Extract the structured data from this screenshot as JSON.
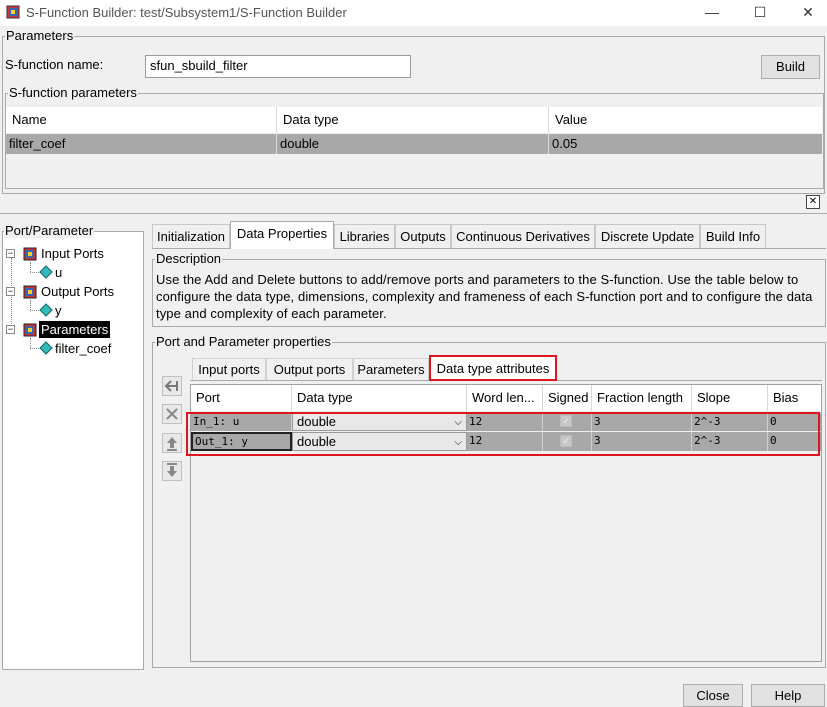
{
  "window": {
    "title": "S-Function Builder: test/Subsystem1/S-Function Builder",
    "minimize": "—",
    "maximize": "☐",
    "close": "✕"
  },
  "parameters_group": {
    "legend": "Parameters",
    "sfunction_name_label": "S-function name:",
    "sfunction_name_value": "sfun_sbuild_filter",
    "build_label": "Build"
  },
  "sfunction_parameters": {
    "legend": "S-function parameters",
    "columns": [
      "Name",
      "Data type",
      "Value"
    ],
    "rows": [
      {
        "name": "filter_coef",
        "data_type": "double",
        "value": "0.05"
      }
    ],
    "close_icon": "✕"
  },
  "port_tree": {
    "legend": "Port/Parameter",
    "items": [
      {
        "label": "Input Ports",
        "icon": "block-icon",
        "children": [
          {
            "label": "u",
            "icon": "port-diamond-icon"
          }
        ]
      },
      {
        "label": "Output Ports",
        "icon": "block-icon",
        "children": [
          {
            "label": "y",
            "icon": "port-diamond-icon"
          }
        ]
      },
      {
        "label": "Parameters",
        "icon": "block-icon",
        "selected": true,
        "children": [
          {
            "label": "filter_coef",
            "icon": "port-diamond-icon"
          }
        ]
      }
    ]
  },
  "tabs": [
    "Initialization",
    "Data Properties",
    "Libraries",
    "Outputs",
    "Continuous Derivatives",
    "Discrete Update",
    "Build Info"
  ],
  "active_tab": "Data Properties",
  "description": {
    "legend": "Description",
    "text": "Use the Add and Delete buttons to add/remove ports and parameters to the S-function. Use the table below to configure the data type, dimensions, complexity and frameness of each S-function port and to configure the data type and complexity of each parameter."
  },
  "port_props": {
    "legend": "Port and Parameter properties",
    "subtabs": [
      "Input ports",
      "Output ports",
      "Parameters",
      "Data type attributes"
    ],
    "active_subtab": "Data type attributes",
    "columns": [
      "Port",
      "Data type",
      "Word len...",
      "Signed",
      "Fraction length",
      "Slope",
      "Bias"
    ],
    "rows": [
      {
        "port": "In_1: u",
        "data_type": "double",
        "word_length": "12",
        "signed": true,
        "fraction_length": "3",
        "slope": "2^-3",
        "bias": "0"
      },
      {
        "port": "Out_1: y",
        "data_type": "double",
        "word_length": "12",
        "signed": true,
        "fraction_length": "3",
        "slope": "2^-3",
        "bias": "0"
      }
    ],
    "highlight_color": "#e0141e"
  },
  "footer": {
    "close_label": "Close",
    "help_label": "Help"
  }
}
